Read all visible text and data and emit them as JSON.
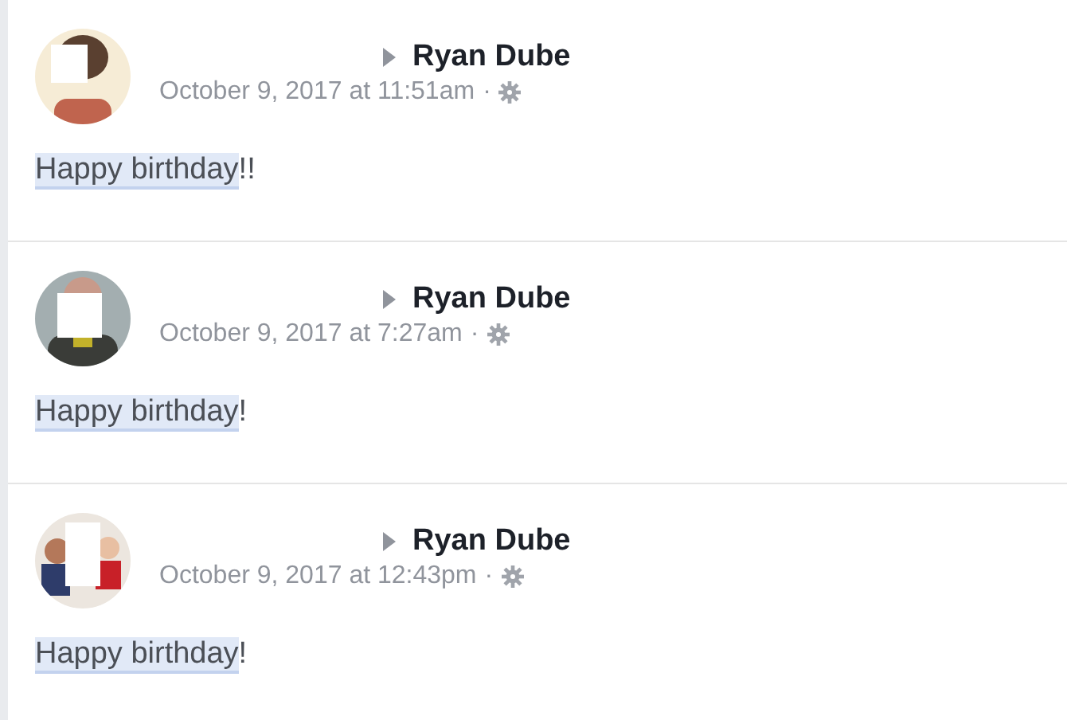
{
  "posts": [
    {
      "recipient": "Ryan Dube",
      "timestamp": "October 9, 2017 at 11:51am",
      "separator": "·",
      "message": {
        "highlight": "Happy birthday",
        "rest": "!!"
      }
    },
    {
      "recipient": "Ryan Dube",
      "timestamp": "October 9, 2017 at 7:27am",
      "separator": "·",
      "message": {
        "highlight": "Happy birthday",
        "rest": "!"
      }
    },
    {
      "recipient": "Ryan Dube",
      "timestamp": "October 9, 2017 at 12:43pm",
      "separator": "·",
      "message": {
        "highlight": "Happy birthday",
        "rest": "!"
      }
    }
  ]
}
